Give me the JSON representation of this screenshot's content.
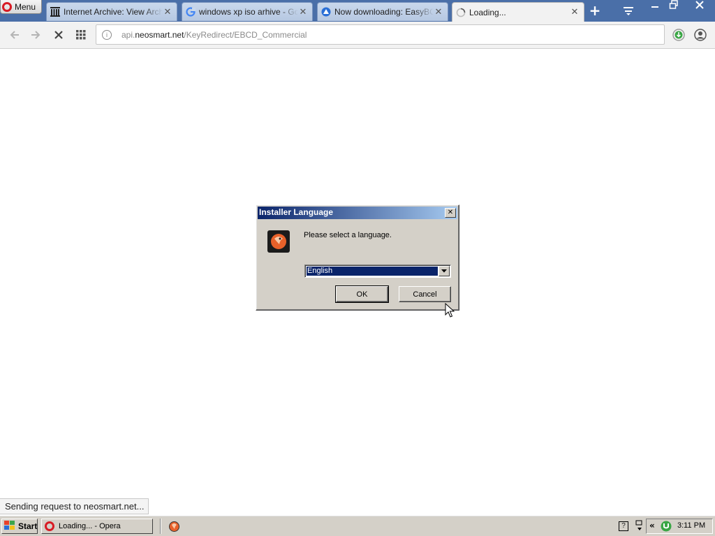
{
  "browser": {
    "menu_label": "Menu",
    "tabs": [
      {
        "title": "Internet Archive: View Archive"
      },
      {
        "title": "windows xp iso arhive - Google Search"
      },
      {
        "title": "Now downloading: EasyBCD"
      },
      {
        "title": "Loading..."
      }
    ],
    "address": {
      "host_pre": "api.",
      "host": "neosmart.net",
      "path": "/KeyRedirect/EBCD_Commercial"
    },
    "status_text": "Sending request to neosmart.net..."
  },
  "dialog": {
    "title": "Installer Language",
    "close_glyph": "✕",
    "message": "Please select a language.",
    "selected_language": "English",
    "ok_label": "OK",
    "cancel_label": "Cancel"
  },
  "taskbar": {
    "start_label": "Start",
    "task_label": "Loading... - Opera",
    "clock": "3:11 PM"
  },
  "colors": {
    "tabstrip": "#4a6fa8",
    "dialog_title_start": "#0a246a",
    "dialog_title_end": "#a6caf0",
    "opera_red": "#d81b24",
    "taskbar": "#d4d0c8"
  },
  "icons": [
    "opera-logo-icon",
    "archive-icon",
    "google-icon",
    "neosmart-icon",
    "spinner-icon",
    "close-icon",
    "plus-icon",
    "tab-menu-icon",
    "minimize-icon",
    "restore-icon",
    "back-icon",
    "forward-icon",
    "stop-icon",
    "speed-dial-icon",
    "info-icon",
    "download-icon",
    "account-icon",
    "installer-icon",
    "dropdown-arrow-icon",
    "windows-flag-icon",
    "help-icon",
    "network-icon",
    "chevron-left-icon",
    "utorrent-icon"
  ]
}
